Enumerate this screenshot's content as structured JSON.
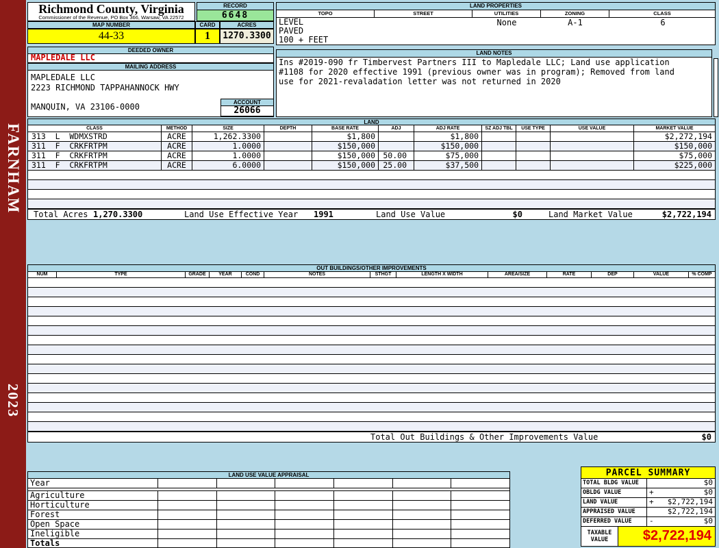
{
  "colors": {
    "sidebar_maroon": "#8c1b17",
    "band_blue": "#add8e6",
    "highlight_yellow": "#ffff00",
    "record_green": "#9ae69a",
    "acres_cream": "#f0eedc",
    "owner_red": "#cc0000",
    "taxable_red": "#e00000"
  },
  "sidebar": {
    "district": "FARNHAM",
    "year": "2023"
  },
  "header": {
    "county_title": "Richmond County, Virginia",
    "commissioner_line": "Commissioner of the Revenue, PO Box 366, Warsaw, VA 22572",
    "record_label": "RECORD",
    "record_number": "6648",
    "map_number_label": "MAP NUMBER",
    "map_number": "44-33",
    "card_label": "CARD",
    "card_number": "1",
    "acres_label": "ACRES",
    "acres": "1270.3300"
  },
  "owner": {
    "deeded_owner_label": "DEEDED OWNER",
    "deeded_owner": "MAPLEDALE LLC",
    "mailing_address_label": "MAILING ADDRESS",
    "address_lines": [
      "MAPLEDALE LLC",
      "2223 RICHMOND TAPPAHANNOCK HWY",
      "MANQUIN, VA 23106-0000"
    ],
    "account_label": "ACCOUNT",
    "account_number": "26066"
  },
  "land_properties": {
    "title": "LAND PROPERTIES",
    "columns": [
      "TOPO",
      "STREET",
      "UTILITIES",
      "ZONING",
      "CLASS"
    ],
    "topo_lines": [
      "LEVEL",
      "PAVED",
      "100 + FEET"
    ],
    "street": "",
    "utilities": "None",
    "zoning": "A-1",
    "class": "6"
  },
  "land_notes": {
    "title": "LAND NOTES",
    "lines": [
      "Ins #2019-090 fr Timbervest Partners III to Mapledale LLC; Land use application",
      "#1108 for 2020 effective 1991 (previous owner was in program); Removed from land",
      "use for 2021-revaladation letter was not returned in 2020"
    ]
  },
  "land": {
    "title": "LAND",
    "columns": [
      "CLASS",
      "METHOD",
      "SIZE",
      "DEPTH",
      "BASE RATE",
      "ADJ",
      "ADJ RATE",
      "SZ ADJ TBL",
      "USE TYPE",
      "USE VALUE",
      "MARKET VALUE"
    ],
    "rows": [
      {
        "class": "313  L  WDMXSTRD",
        "method": "ACRE",
        "size": "1,262.3300",
        "depth": "",
        "base_rate": "$1,800",
        "adj": "",
        "adj_rate": "$1,800",
        "sz_adj_tbl": "",
        "use_type": "",
        "use_value": "",
        "market_value": "$2,272,194"
      },
      {
        "class": "311  F  CRKFRTPM",
        "method": "ACRE",
        "size": "1.0000",
        "depth": "",
        "base_rate": "$150,000",
        "adj": "",
        "adj_rate": "$150,000",
        "sz_adj_tbl": "",
        "use_type": "",
        "use_value": "",
        "market_value": "$150,000"
      },
      {
        "class": "311  F  CRKFRTPM",
        "method": "ACRE",
        "size": "1.0000",
        "depth": "",
        "base_rate": "$150,000",
        "adj": "50.00",
        "adj_rate": "$75,000",
        "sz_adj_tbl": "",
        "use_type": "",
        "use_value": "",
        "market_value": "$75,000"
      },
      {
        "class": "311  F  CRKFRTPM",
        "method": "ACRE",
        "size": "6.0000",
        "depth": "",
        "base_rate": "$150,000",
        "adj": "25.00",
        "adj_rate": "$37,500",
        "sz_adj_tbl": "",
        "use_type": "",
        "use_value": "",
        "market_value": "$225,000"
      }
    ],
    "totals": {
      "total_acres_label": "Total Acres",
      "total_acres": "1,270.3300",
      "effective_year_label": "Land Use Effective Year",
      "effective_year": "1991",
      "use_value_label": "Land Use Value",
      "use_value": "$0",
      "market_value_label": "Land Market Value",
      "market_value": "$2,722,194"
    }
  },
  "out_buildings": {
    "title": "OUT BUILDINGS/OTHER IMPROVEMENTS",
    "columns": [
      "NUM",
      "TYPE",
      "GRADE",
      "YEAR",
      "COND",
      "NOTES",
      "STHGT",
      "LENGTH X WIDTH",
      "AREA/SIZE",
      "RATE",
      "DEP",
      "VALUE",
      "% COMP"
    ],
    "total_label": "Total Out Buildings & Other Improvements Value",
    "total_value": "$0"
  },
  "land_use_appraisal": {
    "title": "LAND USE VALUE APPRAISAL",
    "row_labels": [
      "Year",
      "Agriculture",
      "Horticulture",
      "Forest",
      "Open Space",
      "Ineligible",
      "Totals"
    ]
  },
  "parcel_summary": {
    "title": "PARCEL SUMMARY",
    "rows": [
      {
        "label": "TOTAL BLDG VALUE",
        "sign": "",
        "value": "$0"
      },
      {
        "label": "OBLDG VALUE",
        "sign": "+",
        "value": "$0"
      },
      {
        "label": "LAND VALUE",
        "sign": "+",
        "value": "$2,722,194"
      },
      {
        "label": "APPRAISED VALUE",
        "sign": "",
        "value": "$2,722,194"
      },
      {
        "label": "DEFERRED VALUE",
        "sign": "-",
        "value": "$0"
      }
    ],
    "taxable_label": "TAXABLE VALUE",
    "taxable_value": "$2,722,194"
  }
}
